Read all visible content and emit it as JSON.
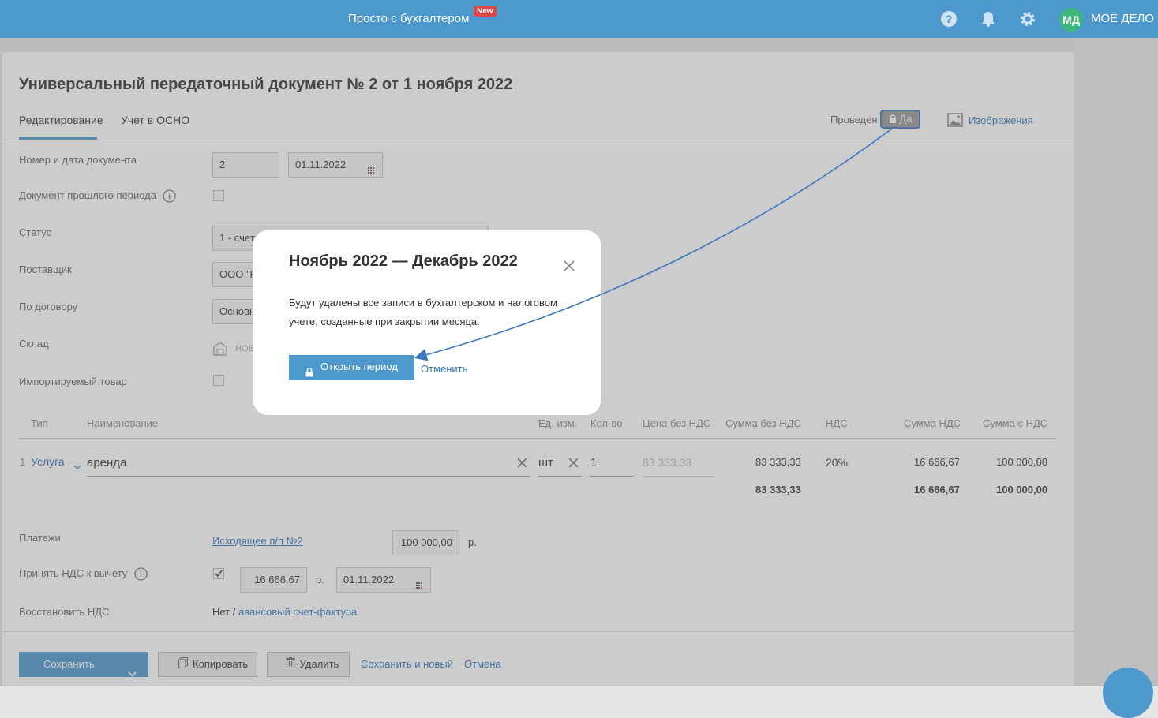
{
  "topbar": {
    "link": "Просто с бухгалтером",
    "badge": "New",
    "avatar": "МД",
    "brand": "МОЁ ДЕЛО",
    "icons": [
      "help-icon",
      "bell-icon",
      "gear-icon"
    ]
  },
  "doc": {
    "title": "Универсальный передаточный документ № 2 от 1 ноября 2022",
    "tabs": [
      "Редактирование",
      "Учет в ОСНО"
    ],
    "posted_label": "Проведен",
    "posted_value": "Да",
    "images_link": "Изображения"
  },
  "form": {
    "number_label": "Номер и дата документа",
    "number": "2",
    "date": "01.11.2022",
    "past_period_label": "Документ прошлого периода",
    "status_label": "Статус",
    "status_value": "1 - счет-",
    "supplier_label": "Поставщик",
    "supplier_value": "ООО \"Р",
    "contract_label": "По договору",
    "contract_value": "Основн",
    "warehouse_label": "Склад",
    "warehouse_value": ":НОВ",
    "imported_label": "Импортируемый товар"
  },
  "table": {
    "headers": [
      "Тип",
      "Наименование",
      "Ед. изм.",
      "Кол-во",
      "Цена без НДС",
      "Сумма без НДС",
      "НДС",
      "Сумма НДС",
      "Сумма с НДС"
    ],
    "row": {
      "num": "1",
      "type": "Услуга",
      "name": "аренда",
      "unit": "шт",
      "qty": "1",
      "price": "83 333,33",
      "sum_no_vat": "83 333,33",
      "vat": "20%",
      "vat_sum": "16 666,67",
      "sum_with_vat": "100 000,00"
    },
    "totals": {
      "sum_no_vat": "83 333,33",
      "vat_sum": "16 666,67",
      "sum_with_vat": "100 000,00"
    }
  },
  "payments": {
    "label": "Платежи",
    "link": "Исходящее п/п №2",
    "amount": "100 000,00",
    "currency": "р."
  },
  "vat_deduct": {
    "label": "Принять НДС к вычету",
    "amount": "16 666,67",
    "currency": "р.",
    "date": "01.11.2022"
  },
  "vat_restore": {
    "label": "Восстановить НДС",
    "value": "Нет /",
    "link": "авансовый счет-фактура"
  },
  "footer": {
    "save": "Сохранить",
    "copy": "Копировать",
    "delete": "Удалить",
    "save_new": "Сохранить и новый",
    "cancel": "Отмена"
  },
  "modal": {
    "title": "Ноябрь 2022 — Декабрь 2022",
    "text": "Будут удалены все записи в бухгалтерском и налоговом учете, созданные при закрытии месяца.",
    "open_button": "Открыть период",
    "cancel_link": "Отменить"
  },
  "colors": {
    "primary": "#4d98cc",
    "link": "#2f78b7",
    "badge": "#e04545",
    "avatar": "#3cb87d",
    "annotation": "#3a78c2"
  }
}
